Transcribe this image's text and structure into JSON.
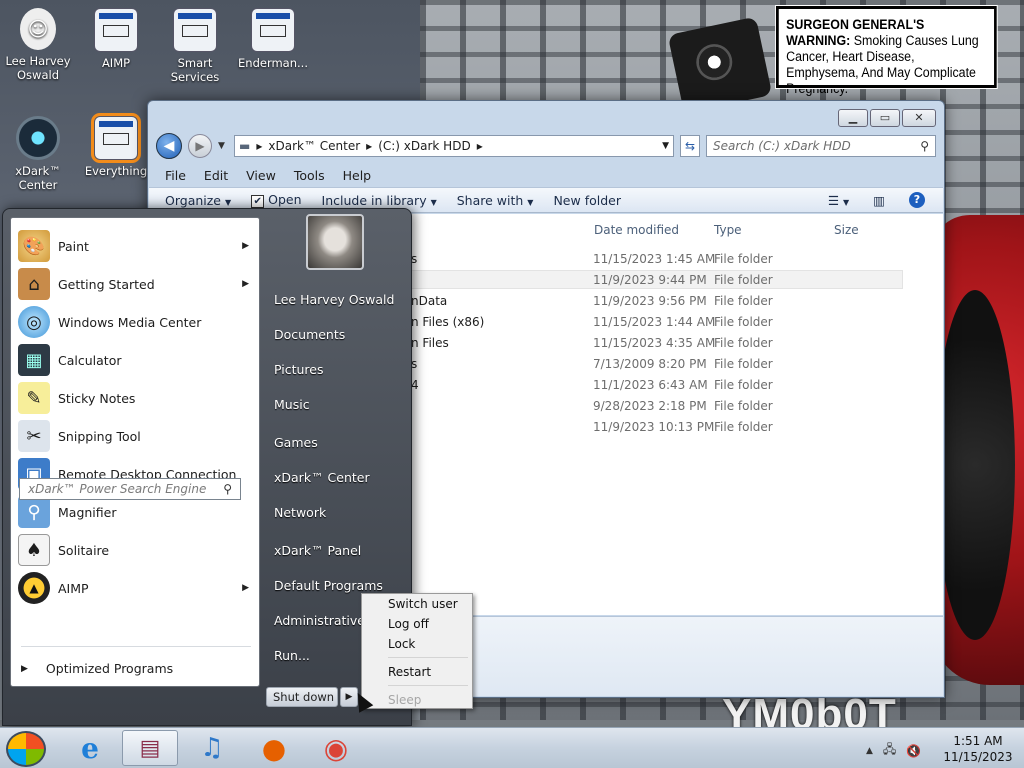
{
  "desktop": {
    "icons": [
      {
        "label": "Lee Harvey Oswald",
        "icon": "user-folder-icon"
      },
      {
        "label": "AIMP",
        "icon": "aimp-icon"
      },
      {
        "label": "Smart Services",
        "icon": "services-icon"
      },
      {
        "label": "Enderman...",
        "icon": "app-icon"
      },
      {
        "label": "xDark™ Center",
        "icon": "xdark-center-icon"
      },
      {
        "label": "Everything",
        "icon": "everything-icon"
      }
    ]
  },
  "wallpaper": {
    "warning_bold": "SURGEON GENERAL'S WARNING:",
    "warning_text": " Smoking Causes Lung Cancer, Heart Disease, Emphysema, And May Complicate Pregnancy.",
    "bottom_text": "YM0b0T"
  },
  "explorer": {
    "window_controls": {
      "minimize": "▁",
      "maximize": "▭",
      "close": "✕"
    },
    "breadcrumb": [
      "xDark™ Center",
      "(C:) xDark HDD"
    ],
    "search_placeholder": "Search (C:) xDark HDD",
    "menu": [
      "File",
      "Edit",
      "View",
      "Tools",
      "Help"
    ],
    "toolbar": {
      "organize": "Organize",
      "open": "Open",
      "include_in_library": "Include in library",
      "share_with": "Share with",
      "new_folder": "New folder"
    },
    "columns": {
      "date": "Date modified",
      "type": "Type",
      "size": "Size"
    },
    "files": [
      {
        "name": "s",
        "date": "11/15/2023 1:45 AM",
        "type": "File folder"
      },
      {
        "name": "",
        "date": "11/9/2023 9:44 PM",
        "type": "File folder"
      },
      {
        "name": "nData",
        "date": "11/9/2023 9:56 PM",
        "type": "File folder"
      },
      {
        "name": "n Files (x86)",
        "date": "11/15/2023 1:44 AM",
        "type": "File folder"
      },
      {
        "name": "n Files",
        "date": "11/15/2023 4:35 AM",
        "type": "File folder"
      },
      {
        "name": "s",
        "date": "7/13/2009 8:20 PM",
        "type": "File folder"
      },
      {
        "name": "4",
        "date": "11/1/2023 6:43 AM",
        "type": "File folder"
      },
      {
        "name": "",
        "date": "9/28/2023 2:18 PM",
        "type": "File folder"
      },
      {
        "name": "",
        "date": "11/9/2023 10:13 PM",
        "type": "File folder"
      }
    ]
  },
  "start_menu": {
    "programs": [
      {
        "label": "Paint",
        "icon": "paint-icon",
        "submenu": true
      },
      {
        "label": "Getting Started",
        "icon": "getting-started-icon",
        "submenu": true
      },
      {
        "label": "Windows Media Center",
        "icon": "media-center-icon",
        "submenu": false
      },
      {
        "label": "Calculator",
        "icon": "calculator-icon",
        "submenu": false
      },
      {
        "label": "Sticky Notes",
        "icon": "sticky-notes-icon",
        "submenu": false
      },
      {
        "label": "Snipping Tool",
        "icon": "snipping-tool-icon",
        "submenu": false
      },
      {
        "label": "Remote Desktop Connection",
        "icon": "remote-desktop-icon",
        "submenu": false
      },
      {
        "label": "Magnifier",
        "icon": "magnifier-icon",
        "submenu": false
      },
      {
        "label": "Solitaire",
        "icon": "solitaire-icon",
        "submenu": false
      },
      {
        "label": "AIMP",
        "icon": "aimp-icon",
        "submenu": true
      }
    ],
    "optimized_programs": "Optimized Programs",
    "search_placeholder": "xDark™ Power Search Engine",
    "right_items": [
      "Lee Harvey Oswald",
      "Documents",
      "Pictures",
      "Music",
      "Games",
      "xDark™ Center",
      "Network",
      "xDark™ Panel",
      "Default Programs",
      "Administrative T",
      "Run..."
    ],
    "shutdown_label": "Shut down"
  },
  "power_menu": {
    "items": [
      "Switch user",
      "Log off",
      "Lock",
      "Restart"
    ],
    "disabled_item": "Sleep"
  },
  "taskbar": {
    "buttons": [
      {
        "icon": "ie-icon",
        "glyph": "e"
      },
      {
        "icon": "winrar-icon",
        "glyph": "▤"
      },
      {
        "icon": "music-icon",
        "glyph": "♫"
      },
      {
        "icon": "firefox-icon",
        "glyph": "●"
      },
      {
        "icon": "chrome-icon",
        "glyph": "◉"
      }
    ],
    "clock_time": "1:51 AM",
    "clock_date": "11/15/2023"
  },
  "colors": {
    "accent": "#1d5fbf",
    "taskbar": "#c6d2df",
    "start_menu": "#3b4048"
  }
}
